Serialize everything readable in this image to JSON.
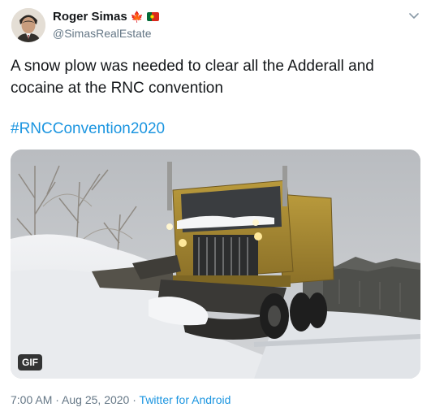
{
  "author": {
    "name": "Roger Simas",
    "handle": "@SimasRealEstate",
    "flags": [
      "canada-flag-icon",
      "portugal-flag-icon"
    ]
  },
  "tweet": {
    "text": "A snow plow was needed to clear all the Adderall and cocaine at the RNC convention",
    "hashtag": "#RNCConvention2020"
  },
  "media": {
    "type": "gif",
    "badge": "GIF",
    "scene": "snow-plow-truck-image"
  },
  "meta": {
    "time": "7:00 AM",
    "separator1": " · ",
    "date": "Aug 25, 2020",
    "separator2": " · ",
    "source": "Twitter for Android"
  },
  "colors": {
    "link": "#1b95e0",
    "muted": "#657786",
    "text": "#14171a"
  }
}
